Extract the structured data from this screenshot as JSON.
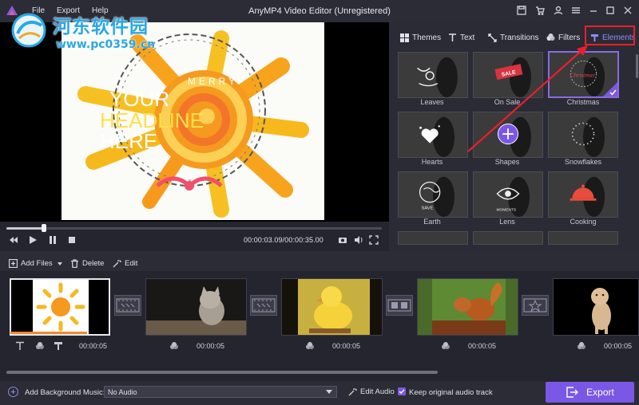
{
  "window": {
    "title": "AnyMP4 Video Editor (Unregistered)",
    "menu": [
      "File",
      "Export",
      "Help"
    ]
  },
  "watermark": {
    "chinese": "河东软件园",
    "url": "www.pc0359.cn"
  },
  "preview": {
    "overlay_text_lines": [
      "YOUR",
      "HEADLINE",
      "HERE"
    ],
    "ribbon_letters": "MERRY",
    "timecode": "00:00:03.09/00:00:35.00",
    "progress_fraction": 0.1
  },
  "panel": {
    "tabs": [
      {
        "label": "Themes",
        "icon": "grid-icon"
      },
      {
        "label": "Text",
        "icon": "text-t-icon"
      },
      {
        "label": "Transitions",
        "icon": "transitions-icon"
      },
      {
        "label": "Filters",
        "icon": "filters-icon"
      },
      {
        "label": "Elements",
        "icon": "elements-icon"
      }
    ],
    "active_tab": "Elements",
    "elements": [
      {
        "label": "Leaves",
        "thumb_text": ""
      },
      {
        "label": "On Sale",
        "thumb_text": "SALE"
      },
      {
        "label": "Christmas",
        "thumb_text": "Christmas",
        "selected": true
      },
      {
        "label": "Hearts",
        "thumb_text": ""
      },
      {
        "label": "Shapes",
        "thumb_text": ""
      },
      {
        "label": "Snowflakes",
        "thumb_text": ""
      },
      {
        "label": "Earth",
        "thumb_text": "SAVE"
      },
      {
        "label": "Lens",
        "thumb_text": "MOMENTS"
      },
      {
        "label": "Cooking",
        "thumb_text": ""
      }
    ]
  },
  "toolbar": {
    "add_files": "Add Files",
    "delete": "Delete",
    "edit": "Edit"
  },
  "timeline": {
    "clips": [
      {
        "name": "sun-drawing",
        "duration": "00:00:05",
        "active": true
      },
      {
        "name": "kitten",
        "duration": "00:00:05"
      },
      {
        "name": "duckling",
        "duration": "00:00:05"
      },
      {
        "name": "squirrel",
        "duration": "00:00:05"
      },
      {
        "name": "cheetah-cub",
        "duration": "00:00:05"
      }
    ]
  },
  "bottom": {
    "add_music_label": "Add Background Music:",
    "audio_value": "No Audio",
    "edit_audio": "Edit Audio",
    "keep_audio": "Keep original audio track",
    "export": "Export"
  },
  "colors": {
    "accent": "#7b57e5",
    "highlight_box": "#e8202a",
    "watermark": "#2aa7e6"
  }
}
